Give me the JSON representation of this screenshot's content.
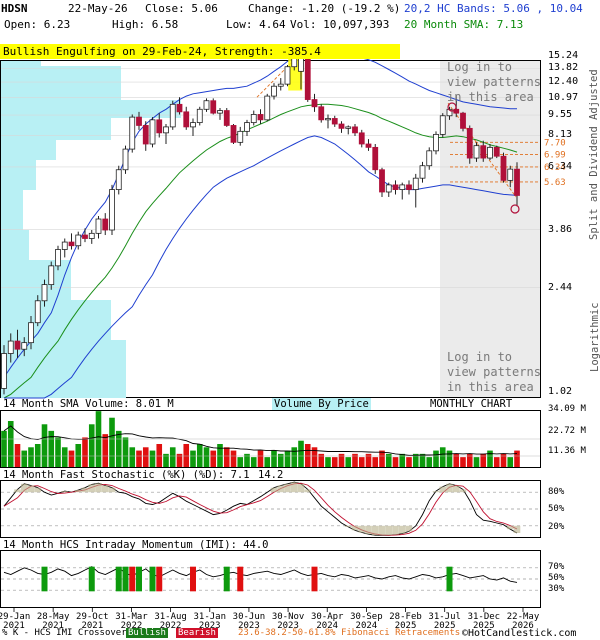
{
  "header": {
    "symbol": "HDSN",
    "date": "22-May-26",
    "close": "Close: 5.06",
    "change": "Change: -1.20 (-19.2 %)",
    "open": "Open: 6.23",
    "high": "High: 6.58",
    "low": "Low: 4.64",
    "vol": "Vol: 10,097,393",
    "bands": "20,2 HC Bands: 5.06 , 10.04",
    "sma": "20 Month SMA: 7.13"
  },
  "pattern_banner": "Bullish Engulfing on 29-Feb-24, Strength: -385.4",
  "watermark_top": [
    "Log in to",
    "view patterns",
    "in this area"
  ],
  "watermark_bottom": [
    "Log in to",
    "view patterns",
    "in this area"
  ],
  "side_labels": {
    "adjusted": "Split and Dividend Adjusted",
    "scale": "Logarithmic"
  },
  "volume_panel": {
    "label": "14 Month SMA Volume: 8.01 M",
    "vbp": "Volume By Price",
    "chart_type": "MONTHLY CHART",
    "ticks": [
      "34.09 M",
      "22.72 M",
      "11.36 M"
    ]
  },
  "stoch_panel": {
    "label": "14 Month Fast Stochastic (%K) (%D): 7.1",
    "label2": "14.2",
    "ticks": [
      "80%",
      "50%",
      "20%"
    ]
  },
  "imi_panel": {
    "label": "14 Month HCS Intraday Momentum (IMI): 44.0",
    "ticks": [
      "70%",
      "50%",
      "30%"
    ]
  },
  "x_labels": [
    "29-Jan 2021",
    "28-May 2021",
    "29-Oct 2021",
    "31-Mar 2022",
    "31-Aug 2022",
    "31-Jan 2023",
    "30-Jun 2023",
    "30-Nov 2023",
    "30-Apr 2024",
    "30-Sep 2024",
    "28-Feb 2025",
    "31-Jul 2025",
    "31-Dec 2025",
    "22-May 2026"
  ],
  "footer": {
    "legend_prefix": "% K - HCS IMI Crossover,",
    "bullish": "Bullish",
    "bearish": "Bearish",
    "fib": "23.6-38.2-50-61.8% Fibonacci Retracements",
    "brand": "©HotCandlestick.com"
  },
  "colors": {
    "up": "#1a7a1a",
    "down": "#b0103a",
    "sma": "#1b8f1b",
    "band": "#1f3fd0",
    "vbp": "#b8f0f4",
    "fib": "#e07020",
    "banner": "#ffff00"
  },
  "chart_data": {
    "type": "candlestick",
    "y_ticks": [
      15.24,
      13.82,
      12.4,
      10.97,
      9.55,
      8.13,
      6.34,
      3.86,
      2.44,
      1.02
    ],
    "fib_labels": [
      "7.70",
      "6.99",
      "6.34",
      "5.63"
    ],
    "candles": [
      [
        1.1,
        1.55,
        1.05,
        1.45
      ],
      [
        1.45,
        1.7,
        1.35,
        1.6
      ],
      [
        1.6,
        1.75,
        1.4,
        1.5
      ],
      [
        1.5,
        1.65,
        1.42,
        1.58
      ],
      [
        1.58,
        1.95,
        1.5,
        1.85
      ],
      [
        1.85,
        2.3,
        1.8,
        2.2
      ],
      [
        2.2,
        2.6,
        2.1,
        2.5
      ],
      [
        2.5,
        3.0,
        2.4,
        2.9
      ],
      [
        2.9,
        3.4,
        2.8,
        3.3
      ],
      [
        3.3,
        3.6,
        3.1,
        3.5
      ],
      [
        3.5,
        3.75,
        3.3,
        3.4
      ],
      [
        3.4,
        3.8,
        3.3,
        3.7
      ],
      [
        3.7,
        3.9,
        3.5,
        3.6
      ],
      [
        3.6,
        3.85,
        3.45,
        3.75
      ],
      [
        3.75,
        4.3,
        3.6,
        4.2
      ],
      [
        4.2,
        4.4,
        3.7,
        3.85
      ],
      [
        3.85,
        5.5,
        3.7,
        5.3
      ],
      [
        5.3,
        6.4,
        5.1,
        6.2
      ],
      [
        6.2,
        7.5,
        6.0,
        7.3
      ],
      [
        7.3,
        9.6,
        7.1,
        9.4
      ],
      [
        9.4,
        9.8,
        8.5,
        8.8
      ],
      [
        8.8,
        9.1,
        7.2,
        7.6
      ],
      [
        7.6,
        9.4,
        7.4,
        9.2
      ],
      [
        9.2,
        9.7,
        8.0,
        8.3
      ],
      [
        8.3,
        8.9,
        7.6,
        8.7
      ],
      [
        8.7,
        10.7,
        8.5,
        10.4
      ],
      [
        10.4,
        11.0,
        9.6,
        9.8
      ],
      [
        9.8,
        10.2,
        8.5,
        8.7
      ],
      [
        8.7,
        9.3,
        8.1,
        9.0
      ],
      [
        9.0,
        10.2,
        8.8,
        10.0
      ],
      [
        10.0,
        10.9,
        9.8,
        10.7
      ],
      [
        10.7,
        10.9,
        9.6,
        9.7
      ],
      [
        9.7,
        10.1,
        9.2,
        9.9
      ],
      [
        9.9,
        10.1,
        8.7,
        8.8
      ],
      [
        8.8,
        8.9,
        7.6,
        7.7
      ],
      [
        7.7,
        8.7,
        7.5,
        8.4
      ],
      [
        8.4,
        9.2,
        8.1,
        9.0
      ],
      [
        9.0,
        9.9,
        8.8,
        9.6
      ],
      [
        9.6,
        10.0,
        8.9,
        9.2
      ],
      [
        9.2,
        11.3,
        9.1,
        11.1
      ],
      [
        11.1,
        12.3,
        10.8,
        12.0
      ],
      [
        12.0,
        12.8,
        11.6,
        12.2
      ],
      [
        12.2,
        14.2,
        12.0,
        14.0
      ],
      [
        14.0,
        15.3,
        13.6,
        15.2
      ],
      [
        13.5,
        15.24,
        11.7,
        15.0
      ],
      [
        15.0,
        15.2,
        10.6,
        10.8
      ],
      [
        10.8,
        11.3,
        9.8,
        10.2
      ],
      [
        10.2,
        10.4,
        9.0,
        9.2
      ],
      [
        9.2,
        9.6,
        8.6,
        9.3
      ],
      [
        9.3,
        9.5,
        8.7,
        8.9
      ],
      [
        8.9,
        9.1,
        8.3,
        8.6
      ],
      [
        8.6,
        8.8,
        8.2,
        8.7
      ],
      [
        8.7,
        8.9,
        8.1,
        8.3
      ],
      [
        8.3,
        8.5,
        7.4,
        7.6
      ],
      [
        7.6,
        7.9,
        7.2,
        7.4
      ],
      [
        7.4,
        7.6,
        6.0,
        6.2
      ],
      [
        6.2,
        6.3,
        5.0,
        5.2
      ],
      [
        5.2,
        5.6,
        5.0,
        5.5
      ],
      [
        5.5,
        5.7,
        5.1,
        5.3
      ],
      [
        5.3,
        5.6,
        4.9,
        5.5
      ],
      [
        5.5,
        5.7,
        5.1,
        5.3
      ],
      [
        5.3,
        6.0,
        4.6,
        5.8
      ],
      [
        5.8,
        6.6,
        5.6,
        6.4
      ],
      [
        6.4,
        7.4,
        6.2,
        7.2
      ],
      [
        7.2,
        8.4,
        7.0,
        8.2
      ],
      [
        8.2,
        9.7,
        8.0,
        9.5
      ],
      [
        9.5,
        10.2,
        9.2,
        10.0
      ],
      [
        10.0,
        11.2,
        9.4,
        9.7
      ],
      [
        9.7,
        9.8,
        8.4,
        8.6
      ],
      [
        8.6,
        8.8,
        6.5,
        6.8
      ],
      [
        6.8,
        7.7,
        6.6,
        7.5
      ],
      [
        7.5,
        7.8,
        6.6,
        6.8
      ],
      [
        6.8,
        7.6,
        6.7,
        7.4
      ],
      [
        7.4,
        7.5,
        6.8,
        6.9
      ],
      [
        6.9,
        7.1,
        5.6,
        5.7
      ],
      [
        5.7,
        6.4,
        5.4,
        6.23
      ],
      [
        6.23,
        6.58,
        4.64,
        5.06
      ]
    ],
    "sma": [
      1.0,
      1.05,
      1.1,
      1.15,
      1.2,
      1.3,
      1.4,
      1.5,
      1.6,
      1.75,
      1.9,
      2.05,
      2.2,
      2.35,
      2.5,
      2.65,
      2.85,
      3.1,
      3.4,
      3.75,
      4.1,
      4.45,
      4.75,
      5.05,
      5.35,
      5.7,
      6.05,
      6.35,
      6.65,
      6.95,
      7.25,
      7.5,
      7.75,
      7.95,
      8.1,
      8.3,
      8.5,
      8.7,
      8.9,
      9.1,
      9.35,
      9.6,
      9.8,
      10.0,
      10.2,
      10.3,
      10.35,
      10.4,
      10.4,
      10.35,
      10.3,
      10.2,
      10.05,
      9.9,
      9.75,
      9.55,
      9.3,
      9.1,
      8.9,
      8.7,
      8.5,
      8.3,
      8.15,
      8.05,
      8.0,
      8.0,
      8.05,
      8.1,
      8.05,
      7.95,
      7.85,
      7.7,
      7.55,
      7.45,
      7.35,
      7.25,
      7.13
    ],
    "upper_band": [
      1.2,
      1.3,
      1.4,
      1.5,
      1.6,
      1.7,
      1.85,
      2.0,
      2.3,
      2.7,
      3.1,
      3.5,
      3.85,
      4.2,
      4.5,
      4.8,
      5.3,
      6.0,
      6.8,
      7.7,
      8.4,
      8.9,
      9.3,
      9.7,
      10.0,
      10.4,
      10.8,
      11.1,
      11.3,
      11.4,
      11.5,
      11.6,
      11.7,
      11.8,
      11.8,
      11.9,
      12.0,
      12.3,
      12.6,
      13.0,
      13.5,
      14.0,
      14.6,
      15.0,
      15.3,
      15.5,
      15.6,
      15.6,
      15.55,
      15.5,
      15.4,
      15.3,
      15.2,
      15.0,
      14.8,
      14.5,
      14.1,
      13.7,
      13.3,
      12.9,
      12.5,
      12.2,
      11.9,
      11.6,
      11.4,
      11.2,
      11.0,
      10.8,
      10.6,
      10.5,
      10.4,
      10.3,
      10.2,
      10.15,
      10.1,
      10.05,
      10.04
    ],
    "lower_band": [
      0.9,
      0.9,
      0.9,
      0.9,
      0.9,
      0.95,
      1.0,
      1.05,
      1.1,
      1.15,
      1.2,
      1.3,
      1.4,
      1.5,
      1.6,
      1.7,
      1.8,
      1.9,
      2.0,
      2.1,
      2.3,
      2.5,
      2.7,
      3.0,
      3.3,
      3.6,
      3.9,
      4.2,
      4.5,
      4.8,
      5.1,
      5.4,
      5.6,
      5.8,
      5.95,
      6.1,
      6.25,
      6.4,
      6.6,
      6.8,
      7.0,
      7.2,
      7.4,
      7.6,
      7.8,
      8.0,
      8.1,
      8.0,
      7.8,
      7.6,
      7.3,
      7.0,
      6.7,
      6.4,
      6.1,
      5.9,
      5.7,
      5.5,
      5.4,
      5.35,
      5.3,
      5.3,
      5.35,
      5.4,
      5.45,
      5.5,
      5.5,
      5.45,
      5.4,
      5.35,
      5.3,
      5.25,
      5.2,
      5.15,
      5.1,
      5.08,
      5.06
    ]
  }
}
